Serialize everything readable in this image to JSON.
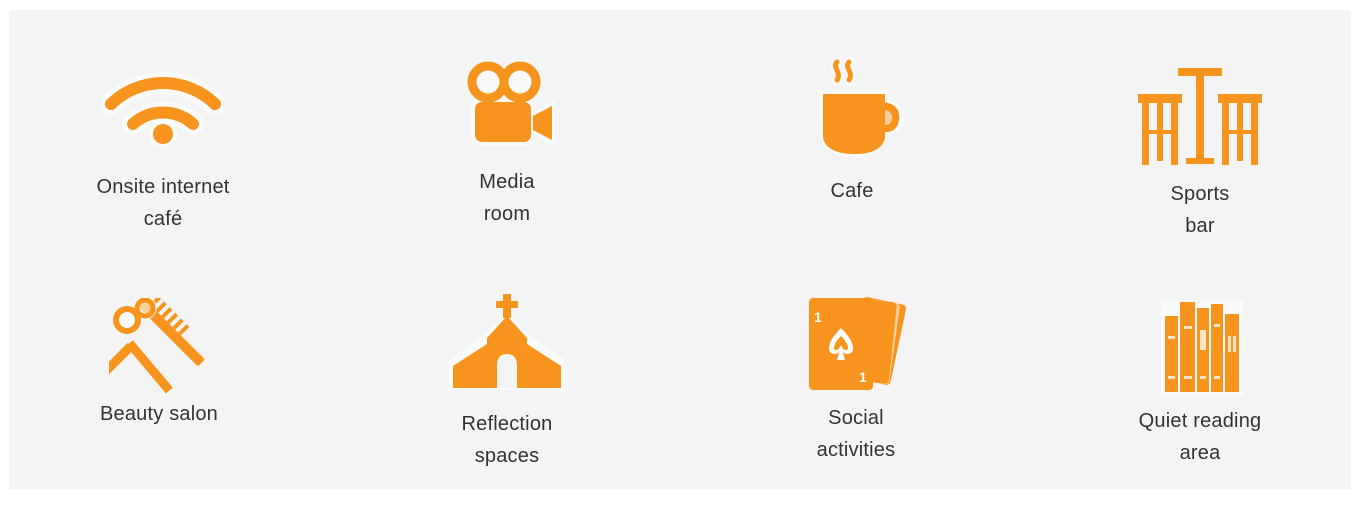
{
  "accent_color": "#f7941d",
  "amenities": [
    {
      "icon": "wifi-icon",
      "label": "Onsite internet\ncafé"
    },
    {
      "icon": "video-camera-icon",
      "label": "Media\nroom"
    },
    {
      "icon": "coffee-cup-icon",
      "label": "Cafe"
    },
    {
      "icon": "bar-stools-icon",
      "label": "Sports\nbar"
    },
    {
      "icon": "scissors-comb-icon",
      "label": "Beauty salon"
    },
    {
      "icon": "chapel-icon",
      "label": "Reflection\nspaces"
    },
    {
      "icon": "playing-cards-icon",
      "label": "Social\nactivities"
    },
    {
      "icon": "books-icon",
      "label": "Quiet reading\narea"
    }
  ]
}
